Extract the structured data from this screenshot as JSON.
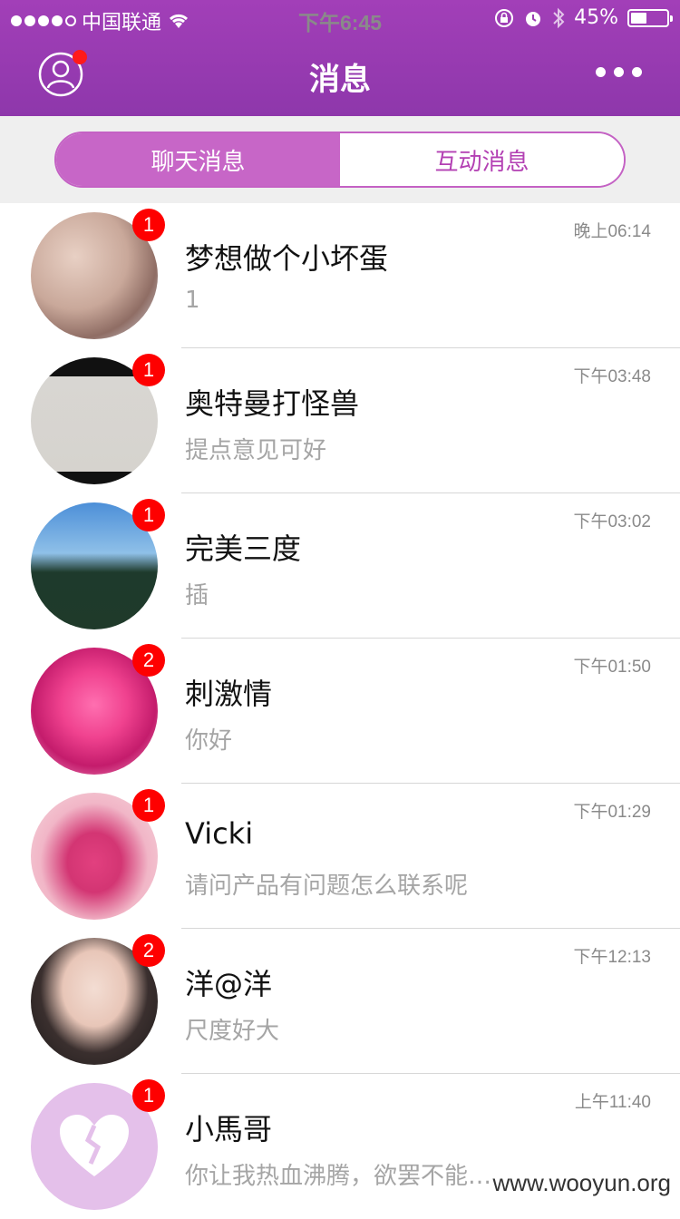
{
  "status_bar": {
    "carrier": "中国联通",
    "time": "下午6:45",
    "battery": "45%",
    "battery_level": 0.45
  },
  "header": {
    "title": "消息",
    "profile_icon": "user-icon",
    "more_icon": "more-dots-icon"
  },
  "tabs": [
    {
      "label": "聊天消息",
      "active": true
    },
    {
      "label": "互动消息",
      "active": false
    }
  ],
  "colors": {
    "header": "#9c3db4",
    "tab_active": "#c766c7",
    "badge": "#fe0000"
  },
  "conversations": [
    {
      "name": "梦想做个小坏蛋",
      "preview": "1",
      "time": "晚上06:14",
      "badge": "1"
    },
    {
      "name": "奥特曼打怪兽",
      "preview": "提点意见可好",
      "time": "下午03:48",
      "badge": "1"
    },
    {
      "name": "完美三度",
      "preview": "插",
      "time": "下午03:02",
      "badge": "1"
    },
    {
      "name": "刺激情",
      "preview": "你好",
      "time": "下午01:50",
      "badge": "2"
    },
    {
      "name": "Vicki",
      "preview": "请问产品有问题怎么联系呢",
      "time": "下午01:29",
      "badge": "1"
    },
    {
      "name": "洋@洋",
      "preview": "尺度好大",
      "time": "下午12:13",
      "badge": "2"
    },
    {
      "name": "小馬哥",
      "preview": "你让我热血沸腾，欲罢不能……",
      "time": "上午11:40",
      "badge": "1"
    }
  ],
  "watermark": "www.wooyun.org"
}
